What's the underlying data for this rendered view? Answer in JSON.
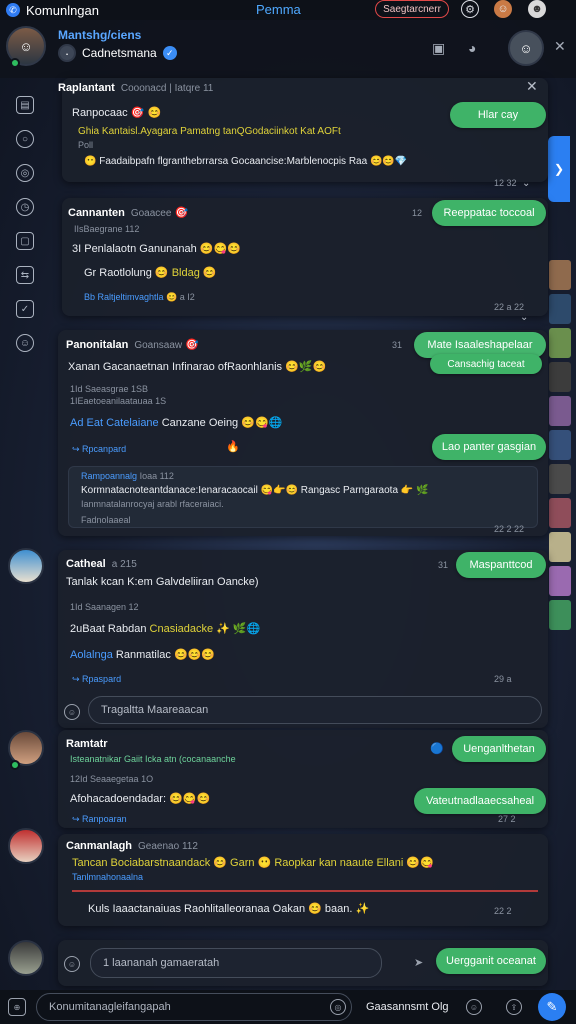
{
  "topbar": {
    "brand": "Komunlngan",
    "center_title": "Pemma",
    "search_label": "Saegtarcnerr"
  },
  "header": {
    "name": "Mantshg/ciens",
    "subtitle": "Cadnetsmana"
  },
  "cards": {
    "c1": {
      "title": "Raplantant",
      "meta": "Cooonacd | Iatqre 11",
      "line1": "Ranpocaac",
      "line2": "Ghia Kantaisl.Ayagara Pamatng tanQGodaciinkot Kat AOFt",
      "line3": "Poll",
      "line4": "Faadaibpafn flgranthebrrarsa Gocaancise:Marblenocpis Raa",
      "reply_pill": "Hlar cay",
      "time": "12 32"
    },
    "c2": {
      "title": "Cannanten",
      "meta": "Goaacee",
      "sub": "IIsBaegrane 112",
      "line1": "3I Penlalaotn Ganunanah",
      "line2": "Gr Raotlolung",
      "line2b": "Bldag",
      "line3": "Bb Raltjeltimvaghtla",
      "line3meta": "a I2",
      "reply_pill": "Reeppatac toccoal",
      "counter": "12",
      "time": "22 a 22"
    },
    "c3": {
      "title": "Panonitalan",
      "meta": "Goansaaw",
      "line1": "Xanan Gacanaetnan Infinarao ofRaonhlanis",
      "sub1": "1Id Saeasgrae 1SB",
      "sub2": "1IEaetoeanilaatauaa 1S",
      "line2": "Ad Eat Catelaiane",
      "line2b": "Canzane Oeing",
      "reply": "Rpcanpard",
      "reply_pill1": "Mate Isaaleshapelaar",
      "reply_pill1b": "Cansachig taceat",
      "reply_pill2": "Lao panter gasgian",
      "counter": "31",
      "quote_title": "Rampoannalg",
      "quote_meta": "Ioaa 112",
      "quote_line1": "Kormnatacnoteantdanace:Ienaracaocail",
      "quote_line1b": "Rangasc Parngaraota",
      "quote_line2": "Ianmnatalanrocyaj arabl rfaceraiaci.",
      "quote_line3": "Fadnolaaeal",
      "time": "22 2 22"
    },
    "c4": {
      "title": "Catheal",
      "meta": "a 215",
      "line1": "Tanlak kcan K:em Galvdeliiran Oancke)",
      "sub1": "1Id Saanagen 12",
      "line2": "2uBaat Rabdan",
      "line2b": "Cnasiadacke",
      "line3": "Aolalnga",
      "line3b": "Ranmatilac",
      "reply": "Rpaspard",
      "reply_pill": "Maspanttcod",
      "counter": "31",
      "input_placeholder": "Tragaltta Maareaacan",
      "time": "29 a"
    },
    "c5": {
      "title": "Ramtatr",
      "line1": "Isteanatnikar Gaiit Icka atn (cocanaanche",
      "sub1": "12Id Seaaegetaa 1O",
      "line2": "Afohacadoendadar:",
      "reply": "Ranpoaran",
      "reply_pill1": "Uenganlthetan",
      "reply_pill2": "Vateutnadlaaecsaheal",
      "time": "27 2"
    },
    "c6": {
      "title": "Canmanlagh",
      "meta": "Geaenao 112",
      "line1": "Tancan Bociabarstnaandack",
      "line1b": "Garn",
      "line1c": "Raopkar kan naaute Ellani",
      "line2": "Tanlmnahonaalna",
      "line3": "Kuls Iaaactanaiuas Raohlitalleoranaa Oakan",
      "line3b": "baan.",
      "time": "22 2"
    },
    "c7": {
      "input_placeholder": "1 laananah gamaeratah",
      "reply_pill": "Uergganit oceanat"
    }
  },
  "bottombar": {
    "input_placeholder": "Konumitanagleifangapah",
    "right_label": "Gaasannsmt Olg"
  },
  "colors": {
    "accent_green": "#3fb368",
    "accent_blue": "#2b7ff2",
    "card_bg": "#1b202c"
  },
  "icons": [
    "bookmark-icon",
    "chat-icon",
    "globe-icon",
    "clock-icon",
    "bell-icon",
    "share-icon",
    "check-icon",
    "emoji-icon"
  ]
}
